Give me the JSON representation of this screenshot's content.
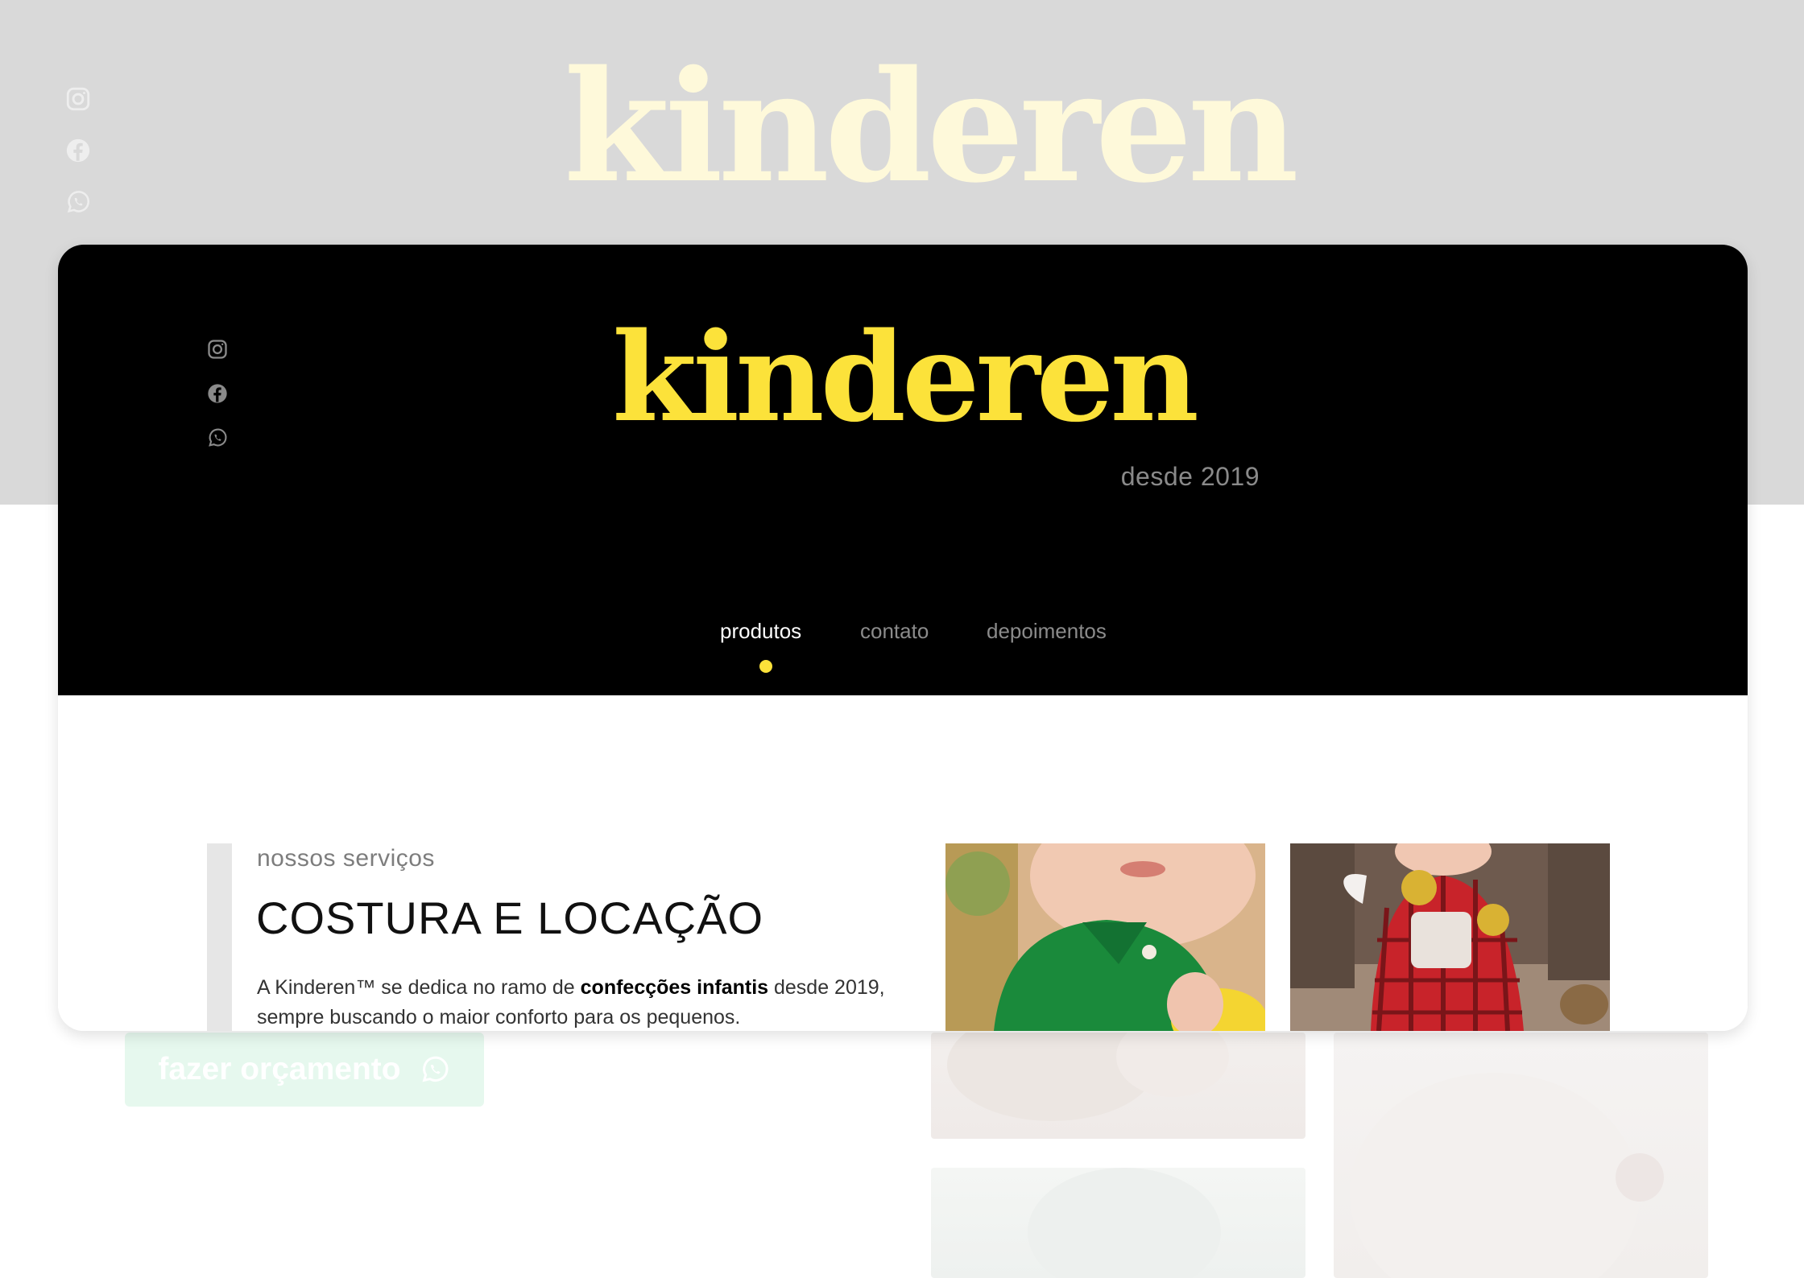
{
  "brand": {
    "name": "kinderen",
    "tagline": "desde 2019"
  },
  "social": [
    {
      "icon": "instagram-icon",
      "label": "Instagram"
    },
    {
      "icon": "facebook-icon",
      "label": "Facebook"
    },
    {
      "icon": "whatsapp-icon",
      "label": "WhatsApp"
    }
  ],
  "nav": {
    "items": [
      {
        "label": "produtos",
        "active": true
      },
      {
        "label": "contato",
        "active": false
      },
      {
        "label": "depoimentos",
        "active": false
      }
    ]
  },
  "services": {
    "eyebrow": "nossos serviços",
    "title": "COSTURA E LOCAÇÃO",
    "description_prefix": "A Kinderen™ se dedica no ramo de ",
    "description_bold": "confecções infantis",
    "description_suffix": " desde 2019, sempre buscando o maior conforto para os pequenos."
  },
  "cta": {
    "label": "fazer orçamento",
    "icon": "whatsapp-icon"
  },
  "colors": {
    "accent": "#fce23a",
    "hero_background": "#000000",
    "page_background": "#d9d9d9",
    "faded_logo": "#fef9da",
    "cta_background": "#e6f8ee"
  }
}
